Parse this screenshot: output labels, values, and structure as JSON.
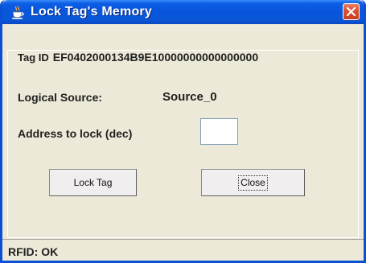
{
  "window": {
    "title": "Lock Tag's Memory",
    "close_symbol": "✕",
    "icon": "java-coffee-cup-icon"
  },
  "form": {
    "tag_id_label": "Tag ID",
    "tag_id_value": "EF0402000134B9E10000000000000000",
    "logical_source_label": "Logical Source:",
    "logical_source_value": "Source_0",
    "address_label": "Address to lock (dec)",
    "address_value": ""
  },
  "buttons": {
    "lock_label": "Lock Tag",
    "close_label": "Close"
  },
  "status": {
    "text": "RFID: OK"
  },
  "colors": {
    "titlebar": "#0a57d9",
    "close_button": "#d9512f",
    "window_bg": "#ece9d8"
  }
}
